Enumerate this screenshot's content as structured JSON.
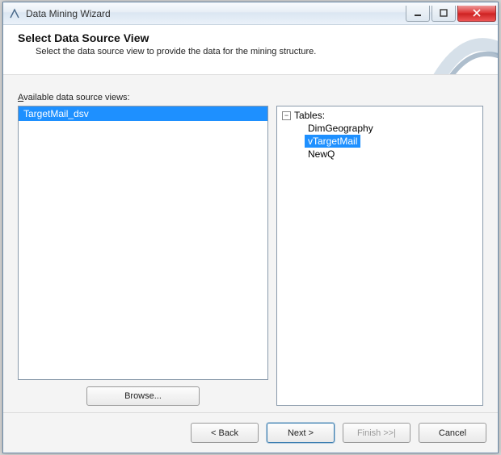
{
  "window": {
    "title": "Data Mining Wizard"
  },
  "header": {
    "title": "Select Data Source View",
    "subtitle": "Select the data source view to provide the data for the mining structure."
  },
  "labels": {
    "available_prefix": "A",
    "available_rest": "vailable data source views:"
  },
  "dsv_list": {
    "items": [
      "TargetMail_dsv"
    ],
    "selected": "TargetMail_dsv"
  },
  "tree": {
    "root_label": "Tables:",
    "expanded": true,
    "items": [
      "DimGeography",
      "vTargetMail",
      "NewQ"
    ],
    "selected": "vTargetMail"
  },
  "buttons": {
    "browse": "Browse...",
    "back": "< Back",
    "next": "Next >",
    "finish": "Finish >>|",
    "cancel": "Cancel"
  }
}
